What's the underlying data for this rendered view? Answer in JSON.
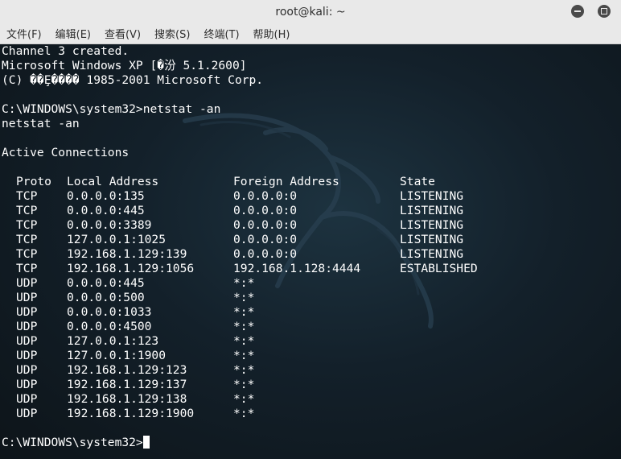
{
  "window": {
    "title": "root@kali: ~"
  },
  "menu": [
    "文件(F)",
    "编辑(E)",
    "查看(V)",
    "搜索(S)",
    "终端(T)",
    "帮助(H)"
  ],
  "terminal": {
    "lines_top": [
      "Channel 3 created.",
      "Microsoft Windows XP [�汾 5.1.2600]",
      "(C) ��Ȩ���� 1985-2001 Microsoft Corp.",
      "",
      "C:\\WINDOWS\\system32>netstat -an",
      "netstat -an",
      "",
      "Active Connections",
      ""
    ],
    "table_header": {
      "proto": "Proto",
      "local": "Local Address",
      "foreign": "Foreign Address",
      "state": "State"
    },
    "connections": [
      {
        "proto": "TCP",
        "local": "0.0.0.0:135",
        "foreign": "0.0.0.0:0",
        "state": "LISTENING"
      },
      {
        "proto": "TCP",
        "local": "0.0.0.0:445",
        "foreign": "0.0.0.0:0",
        "state": "LISTENING"
      },
      {
        "proto": "TCP",
        "local": "0.0.0.0:3389",
        "foreign": "0.0.0.0:0",
        "state": "LISTENING"
      },
      {
        "proto": "TCP",
        "local": "127.0.0.1:1025",
        "foreign": "0.0.0.0:0",
        "state": "LISTENING"
      },
      {
        "proto": "TCP",
        "local": "192.168.1.129:139",
        "foreign": "0.0.0.0:0",
        "state": "LISTENING"
      },
      {
        "proto": "TCP",
        "local": "192.168.1.129:1056",
        "foreign": "192.168.1.128:4444",
        "state": "ESTABLISHED"
      },
      {
        "proto": "UDP",
        "local": "0.0.0.0:445",
        "foreign": "*:*",
        "state": ""
      },
      {
        "proto": "UDP",
        "local": "0.0.0.0:500",
        "foreign": "*:*",
        "state": ""
      },
      {
        "proto": "UDP",
        "local": "0.0.0.0:1033",
        "foreign": "*:*",
        "state": ""
      },
      {
        "proto": "UDP",
        "local": "0.0.0.0:4500",
        "foreign": "*:*",
        "state": ""
      },
      {
        "proto": "UDP",
        "local": "127.0.0.1:123",
        "foreign": "*:*",
        "state": ""
      },
      {
        "proto": "UDP",
        "local": "127.0.0.1:1900",
        "foreign": "*:*",
        "state": ""
      },
      {
        "proto": "UDP",
        "local": "192.168.1.129:123",
        "foreign": "*:*",
        "state": ""
      },
      {
        "proto": "UDP",
        "local": "192.168.1.129:137",
        "foreign": "*:*",
        "state": ""
      },
      {
        "proto": "UDP",
        "local": "192.168.1.129:138",
        "foreign": "*:*",
        "state": ""
      },
      {
        "proto": "UDP",
        "local": "192.168.1.129:1900",
        "foreign": "*:*",
        "state": ""
      }
    ],
    "prompt": "C:\\WINDOWS\\system32>"
  },
  "colors": {
    "titlebar": "#e9e9e9",
    "terminal_bg": "#13202a",
    "text": "#ffffff"
  },
  "icons": {
    "minimize": "minimize-icon",
    "maximize": "maximize-icon",
    "background": "kali-dragon-logo"
  }
}
